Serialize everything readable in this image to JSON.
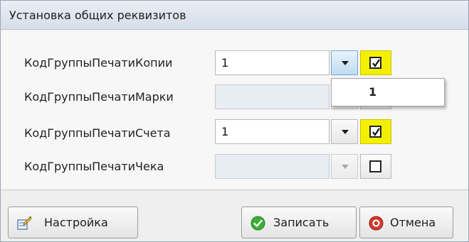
{
  "window": {
    "title": "Установка общих реквизитов"
  },
  "rows": [
    {
      "label": "КодГруппыПечатиКопии",
      "value": "1",
      "enabled": true,
      "checked": true,
      "highlighted": true,
      "dropdown_open": true
    },
    {
      "label": "КодГруппыПечатиМарки",
      "value": "",
      "enabled": false,
      "checked": null,
      "highlighted": false,
      "dropdown_open": false
    },
    {
      "label": "КодГруппыПечатиСчета",
      "value": "1",
      "enabled": true,
      "checked": true,
      "highlighted": true,
      "dropdown_open": false
    },
    {
      "label": "КодГруппыПечатиЧека",
      "value": "",
      "enabled": false,
      "checked": false,
      "highlighted": false,
      "dropdown_open": false
    }
  ],
  "dropdown": {
    "options": [
      "1"
    ]
  },
  "buttons": {
    "settings_label": "Настройка",
    "save_label": "Записать",
    "cancel_label": "Отмена"
  },
  "icons": {
    "settings": "settings-edit-icon",
    "save": "green-check-icon",
    "cancel": "red-cancel-icon",
    "dropdown": "chevron-down-icon",
    "checkbox": "checkmark-icon"
  },
  "colors": {
    "highlight": "#f2f000",
    "active_dropdown": "#bfdcf1",
    "save_icon": "#3fae3a",
    "cancel_icon": "#d3382f"
  }
}
